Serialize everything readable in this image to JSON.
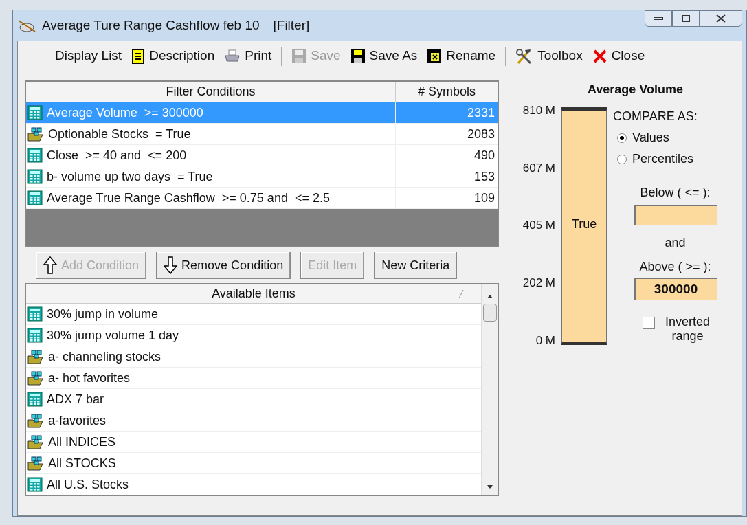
{
  "window": {
    "title": "Average Ture Range Cashflow feb 10",
    "tag": "[Filter]"
  },
  "toolbar": [
    {
      "kind": "list",
      "label": "Display List",
      "disabled": false
    },
    {
      "kind": "description",
      "label": "Description",
      "disabled": false
    },
    {
      "kind": "print",
      "label": "Print",
      "disabled": false
    },
    {
      "kind": "save",
      "label": "Save",
      "disabled": true
    },
    {
      "kind": "save_as",
      "label": "Save As",
      "disabled": false
    },
    {
      "kind": "rename",
      "label": "Rename",
      "disabled": false
    },
    {
      "kind": "toolbox",
      "label": "Toolbox",
      "disabled": false
    },
    {
      "kind": "close",
      "label": "Close",
      "disabled": false
    }
  ],
  "conditions": {
    "columns": [
      "Filter Conditions",
      "# Symbols"
    ],
    "rows": [
      {
        "kind": "formula",
        "condition": "Average Volume  >= 300000",
        "count": "2331",
        "selected": true
      },
      {
        "kind": "list",
        "condition": "Optionable Stocks  = True",
        "count": "2083",
        "selected": false
      },
      {
        "kind": "formula",
        "condition": "Close  >= 40 and  <= 200",
        "count": "490",
        "selected": false
      },
      {
        "kind": "formula",
        "condition": "b- volume up two days  = True",
        "count": "153",
        "selected": false
      },
      {
        "kind": "formula",
        "condition": "Average True Range Cashflow  >= 0.75 and  <= 2.5",
        "count": "109",
        "selected": false
      }
    ]
  },
  "buttons": [
    {
      "kind": "add",
      "label": "Add Condition",
      "disabled": true
    },
    {
      "kind": "remove",
      "label": "Remove Condition",
      "disabled": false
    },
    {
      "kind": "plain",
      "label": "Edit Item",
      "disabled": true
    },
    {
      "kind": "plain",
      "label": "New Criteria",
      "disabled": false
    }
  ],
  "available": {
    "column": "Available Items",
    "items": [
      {
        "kind": "formula",
        "label": "30% jump in volume"
      },
      {
        "kind": "formula",
        "label": "30% jump volume 1 day"
      },
      {
        "kind": "list",
        "label": "a- channeling stocks"
      },
      {
        "kind": "list",
        "label": "a- hot favorites"
      },
      {
        "kind": "formula",
        "label": "ADX 7 bar"
      },
      {
        "kind": "list",
        "label": "a-favorites"
      },
      {
        "kind": "list",
        "label": "All INDICES"
      },
      {
        "kind": "list",
        "label": "All STOCKS"
      },
      {
        "kind": "formula",
        "label": "All U.S. Stocks"
      }
    ]
  },
  "range": {
    "title": "Average Volume",
    "scale": [
      "810 M",
      "607 M",
      "405 M",
      "202 M",
      "0 M"
    ],
    "bar_label": "True",
    "compare_label": "COMPARE AS:",
    "options": [
      {
        "label": "Values",
        "selected": true
      },
      {
        "label": "Percentiles",
        "selected": false
      }
    ],
    "below_label": "Below ( <= ):",
    "and_label": "and",
    "above_label": "Above ( >= ):",
    "above_value": "300000",
    "inverted": {
      "label": "Inverted range",
      "checked": false
    }
  }
}
